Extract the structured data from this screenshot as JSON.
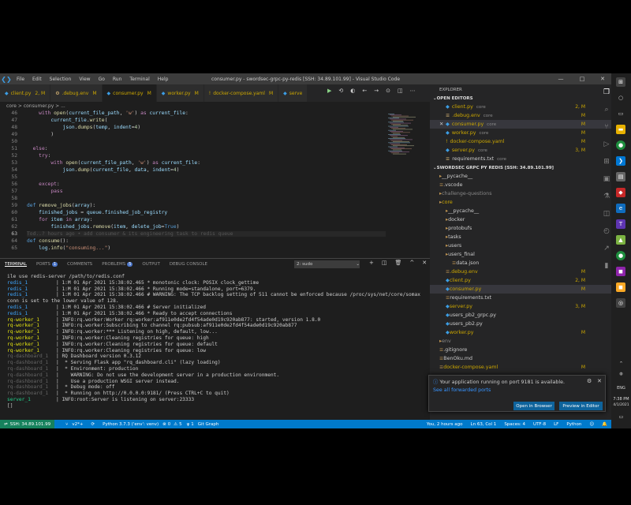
{
  "titlebar": {
    "menus": [
      "File",
      "Edit",
      "Selection",
      "View",
      "Go",
      "Run",
      "Terminal",
      "Help"
    ],
    "title": "consumer.py - swordsec-grpc-py-redis [SSH: 34.89.101.99] - Visual Studio Code"
  },
  "tabs": [
    {
      "label": "client.py",
      "mod": "2, M",
      "icon": "py"
    },
    {
      "label": ".debug.env",
      "mod": "M",
      "icon": "env"
    },
    {
      "label": "consumer.py",
      "mod": "M",
      "icon": "py",
      "active": true
    },
    {
      "label": "worker.py",
      "mod": "M",
      "icon": "py"
    },
    {
      "label": "docker-compose.yaml",
      "mod": "M",
      "icon": "yml"
    },
    {
      "label": "serve",
      "mod": "",
      "icon": "py"
    }
  ],
  "breadcrumb": "core > consumer.py > ...",
  "editor": {
    "line_numbers": [
      "46",
      "47",
      "48",
      "49",
      "50",
      "51",
      "52",
      "53",
      "54",
      "55",
      "56",
      "57",
      "58",
      "59",
      "60",
      "61",
      "62",
      "63",
      "64",
      "65"
    ],
    "ghost_text": "Tod..? hours ago • add consumer & its engineering task to redis queue"
  },
  "panel": {
    "tabs": [
      "TERMINAL",
      "PORTS",
      "COMMENTS",
      "PROBLEMS",
      "OUTPUT",
      "DEBUG CONSOLE"
    ],
    "ports_badge": "1",
    "problems_badge": "5",
    "terminal_select": "2: sudo"
  },
  "terminal": [
    [
      "",
      "ile use redis-server /path/to/redis.conf"
    ],
    [
      "redis_1",
      "| 1:M 01 Apr 2021 15:38:02.465 * monotonic clock: POSIX clock_gettime"
    ],
    [
      "redis_1",
      "| 1:M 01 Apr 2021 15:38:02.466 * Running mode=standalone, port=6379."
    ],
    [
      "redis_1",
      "| 1:M 01 Apr 2021 15:38:02.466 # WARNING: The TCP backlog setting of 511 cannot be enforced because /proc/sys/net/core/somax"
    ],
    [
      "",
      "conn is set to the lower value of 128."
    ],
    [
      "redis_1",
      "| 1:M 01 Apr 2021 15:38:02.466 # Server initialized"
    ],
    [
      "redis_1",
      "| 1:M 01 Apr 2021 15:38:02.466 * Ready to accept connections"
    ],
    [
      "rq-worker_1",
      "| INFO:rq.worker:Worker rq:worker:af911e0de2fd4f54ade0d19c920ab877: started, version 1.8.0"
    ],
    [
      "rq-worker_1",
      "| INFO:rq.worker:Subscribing to channel rq:pubsub:af911e0de2fd4f54ade0d19c920ab877"
    ],
    [
      "rq-worker_1",
      "| INFO:rq.worker:*** Listening on high, default, low..."
    ],
    [
      "rq-worker_1",
      "| INFO:rq.worker:Cleaning registries for queue: high"
    ],
    [
      "rq-worker_1",
      "| INFO:rq.worker:Cleaning registries for queue: default"
    ],
    [
      "rq-worker_1",
      "| INFO:rq.worker:Cleaning registries for queue: low"
    ],
    [
      "rq-dashboard_1",
      "| RQ Dashboard version 0.3.12"
    ],
    [
      "rq-dashboard_1",
      "|  * Serving Flask app \"rq_dashboard.cli\" (lazy loading)"
    ],
    [
      "rq-dashboard_1",
      "|  * Environment: production"
    ],
    [
      "rq-dashboard_1",
      "|    WARNING: Do not use the development server in a production environment."
    ],
    [
      "rq-dashboard_1",
      "|    Use a production WSGI server instead."
    ],
    [
      "rq-dashboard_1",
      "|  * Debug mode: off"
    ],
    [
      "rq-dashboard_1",
      "|  * Running on http://0.0.0.0:9181/ (Press CTRL+C to quit)"
    ],
    [
      "server_1",
      "| INFO:root:Server is listening on server:23333"
    ],
    [
      "",
      "[]"
    ]
  ],
  "explorer": {
    "title": "EXPLORER",
    "open_editors_label": "OPEN EDITORS",
    "open_editors": [
      {
        "name": "client.py",
        "dir": "core",
        "mod": "2, M"
      },
      {
        "name": ".debug.env",
        "dir": "core",
        "mod": "M"
      },
      {
        "name": "consumer.py",
        "dir": "core",
        "mod": "M",
        "active": true
      },
      {
        "name": "worker.py",
        "dir": "core",
        "mod": "M"
      },
      {
        "name": "docker-compose.yaml",
        "dir": "",
        "mod": "M"
      },
      {
        "name": "server.py",
        "dir": "core",
        "mod": "3, M"
      },
      {
        "name": "requirements.txt",
        "dir": "core",
        "mod": ""
      }
    ],
    "project_label": "SWORDSEC GRPC PY REDIS [SSH: 34.89.101.99]",
    "tree": [
      {
        "name": "__pycache__",
        "indent": 1,
        "mod": ""
      },
      {
        "name": ".vscode",
        "indent": 1,
        "mod": ""
      },
      {
        "name": "challenge-questions",
        "indent": 1,
        "mod": ""
      },
      {
        "name": "core",
        "indent": 1,
        "mod": "",
        "color": "#cca700"
      },
      {
        "name": "__pycache__",
        "indent": 2,
        "mod": ""
      },
      {
        "name": "docker",
        "indent": 2,
        "mod": ""
      },
      {
        "name": "protobufs",
        "indent": 2,
        "mod": ""
      },
      {
        "name": "tasks",
        "indent": 2,
        "mod": ""
      },
      {
        "name": "users",
        "indent": 2,
        "mod": ""
      },
      {
        "name": "users_final",
        "indent": 2,
        "mod": ""
      },
      {
        "name": "data.json",
        "indent": 3,
        "mod": ""
      },
      {
        "name": ".debug.env",
        "indent": 2,
        "mod": "M"
      },
      {
        "name": "client.py",
        "indent": 2,
        "mod": "2, M"
      },
      {
        "name": "consumer.py",
        "indent": 2,
        "mod": "M",
        "active": true
      },
      {
        "name": "requirements.txt",
        "indent": 2,
        "mod": ""
      },
      {
        "name": "server.py",
        "indent": 2,
        "mod": "3, M"
      },
      {
        "name": "users_pb2_grpc.py",
        "indent": 2,
        "mod": ""
      },
      {
        "name": "users_pb2.py",
        "indent": 2,
        "mod": ""
      },
      {
        "name": "worker.py",
        "indent": 2,
        "mod": "M"
      },
      {
        "name": "env",
        "indent": 1,
        "mod": ""
      },
      {
        "name": ".gitignore",
        "indent": 1,
        "mod": ""
      },
      {
        "name": "BenOku.md",
        "indent": 1,
        "mod": ""
      },
      {
        "name": "docker-compose.yaml",
        "indent": 1,
        "mod": "M"
      }
    ]
  },
  "notification": {
    "message": "Your application running on port 9181 is available.",
    "link": "See all forwarded ports",
    "open_browser": "Open in Browser",
    "preview": "Preview in Editor"
  },
  "status": {
    "ssh": "SSH: 34.89.101.99",
    "branch": "v2*+",
    "python": "Python 3.7.3 ('env': venv)",
    "errors": "0",
    "warnings": "5",
    "sync": "1",
    "gitgraph": "Git Graph",
    "blame": "You, 2 hours ago",
    "position": "Ln 63, Col 1",
    "spaces": "Spaces: 4",
    "encoding": "UTF-8",
    "eol": "LF",
    "language": "Python"
  },
  "taskbar": {
    "lang": "ENG",
    "time": "7:38 PM",
    "date": "4/1/2021"
  }
}
